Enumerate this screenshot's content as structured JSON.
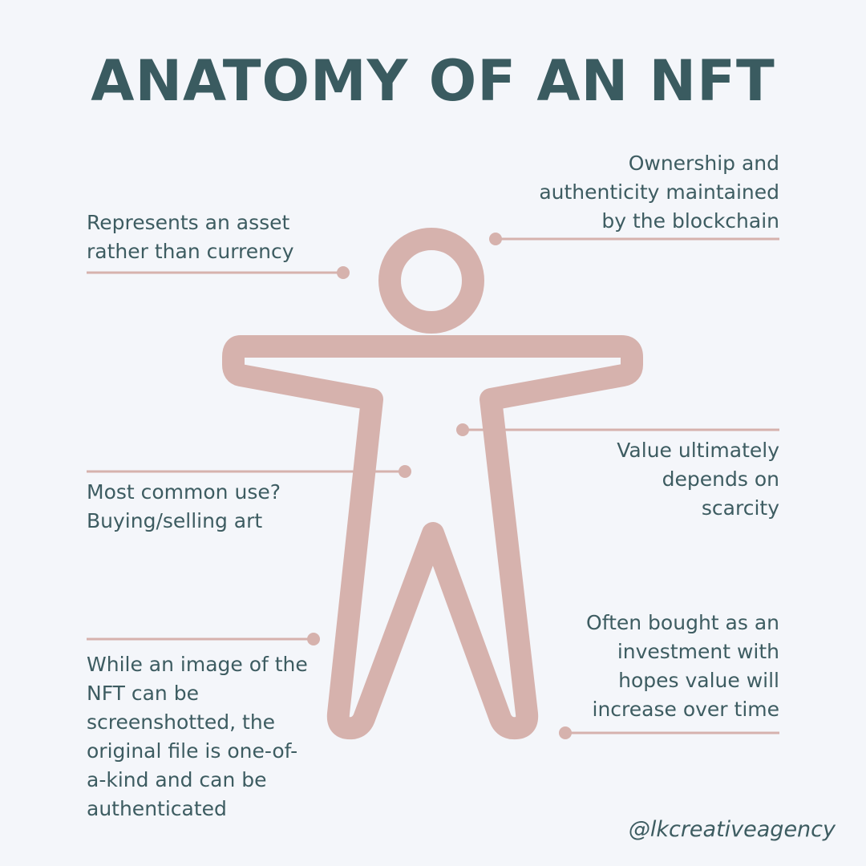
{
  "title": "ANATOMY OF AN NFT",
  "annotations": {
    "ownership": [
      "Ownership and",
      "authenticity maintained",
      "by the blockchain"
    ],
    "represents": [
      "Represents an asset",
      "rather than currency"
    ],
    "value": [
      "Value ultimately",
      "depends on",
      "scarcity"
    ],
    "common_use": [
      "Most common use?",
      "Buying/selling art"
    ],
    "investment": [
      "Often bought as an",
      "investment with",
      "hopes value will",
      "increase over time"
    ],
    "image": [
      "While an image of the",
      "NFT can be",
      "screenshotted, the",
      "original file is one-of-",
      "a-kind and can be",
      "authenticated"
    ]
  },
  "handle": "@lkcreativeagency",
  "colors": {
    "figure": "#d6b2ad",
    "text": "#3d5c61",
    "background": "#f4f6fa"
  },
  "icons": {
    "figure": "person-outline-icon"
  }
}
